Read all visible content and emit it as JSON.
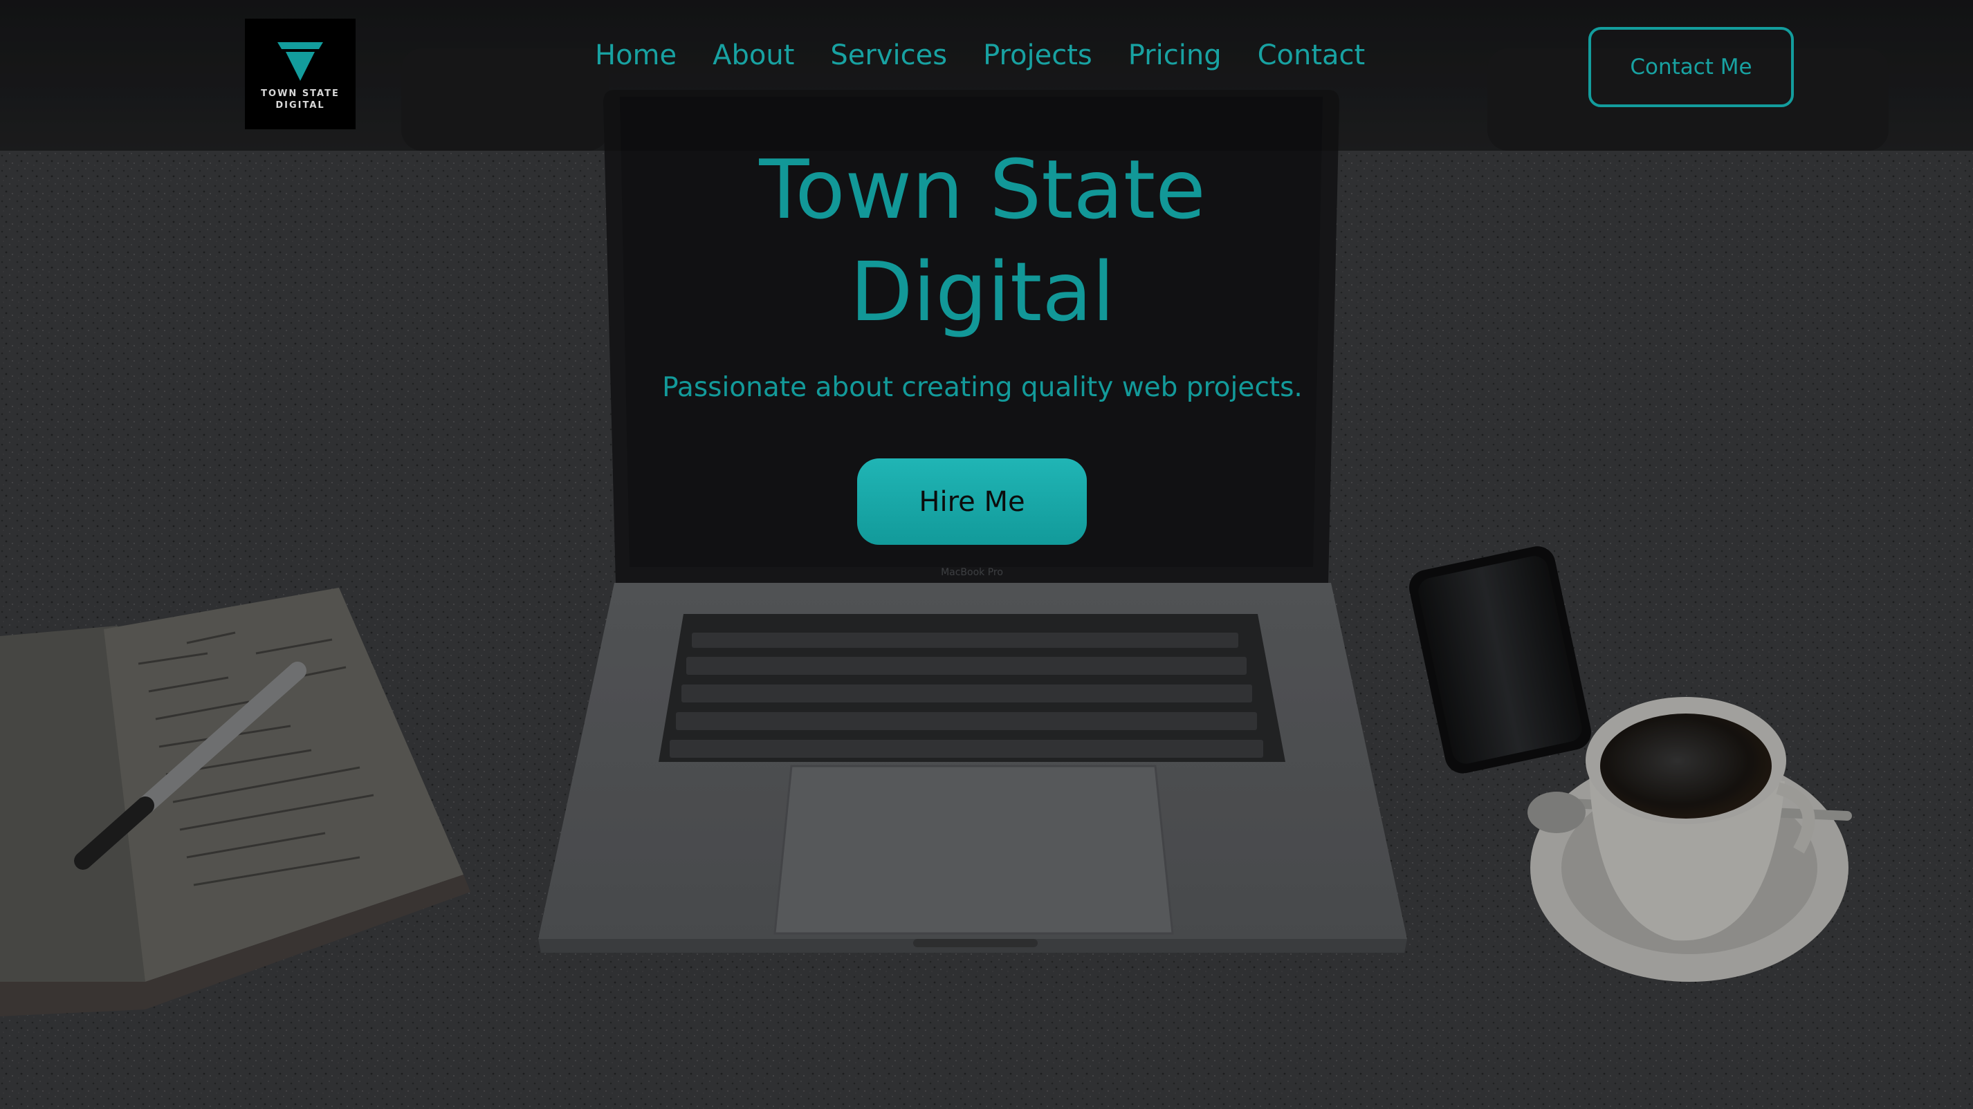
{
  "brand": {
    "logo_line1": "TOWN STATE",
    "logo_line2": "DIGITAL",
    "accent": "#139d9d",
    "logo_icon": "diamond-icon"
  },
  "nav": {
    "items": [
      {
        "label": "Home"
      },
      {
        "label": "About"
      },
      {
        "label": "Services"
      },
      {
        "label": "Projects"
      },
      {
        "label": "Pricing"
      },
      {
        "label": "Contact"
      }
    ],
    "cta_label": "Contact Me"
  },
  "hero": {
    "title_line1": "Town State",
    "title_line2": "Digital",
    "subtitle": "Passionate about creating quality web projects.",
    "button_label": "Hire Me",
    "laptop_label": "MacBook Pro"
  }
}
